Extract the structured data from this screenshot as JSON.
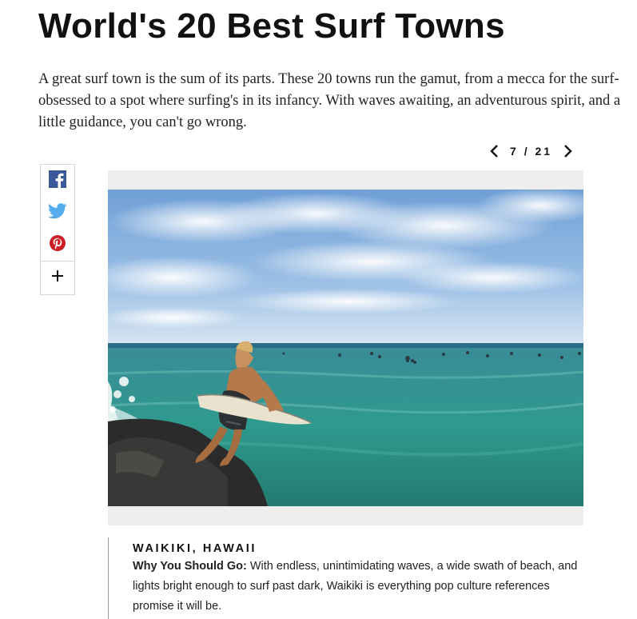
{
  "article": {
    "title": "World's 20 Best Surf Towns",
    "intro": "A great surf town is the sum of its parts. These 20 towns run the gamut, from a mecca for the surf-obsessed to a spot where surfing's in its infancy. With waves awaiting, an adventurous spirit, and a little guidance, you can't go wrong."
  },
  "slideshow": {
    "current": "7",
    "separator": "/",
    "total": "21",
    "prev_icon": "chevron-left-icon",
    "next_icon": "chevron-right-icon"
  },
  "share": {
    "items": [
      {
        "icon": "facebook-icon",
        "color": "#3b5998"
      },
      {
        "icon": "twitter-icon",
        "color": "#55acee"
      },
      {
        "icon": "pinterest-icon",
        "color": "#cb2027"
      },
      {
        "icon": "plus-icon",
        "color": "#111111"
      }
    ]
  },
  "slide": {
    "location": "WAIKIKI, HAWAII",
    "why_label": "Why You Should Go:",
    "why_text": " With endless, unintimidating waves, a wide swath of beach, and lights bright enough to surf past dark, Waikiki is everything pop culture references promise it will be."
  }
}
